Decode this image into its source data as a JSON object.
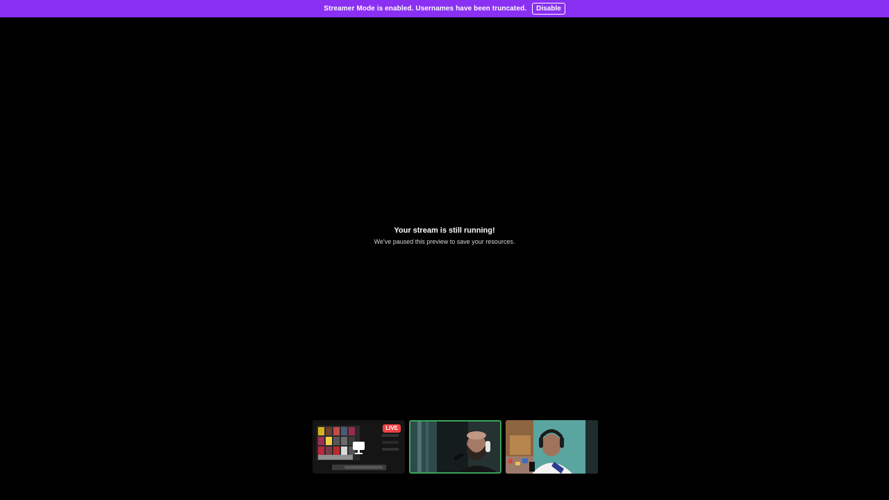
{
  "banner": {
    "message": "Streamer Mode is enabled. Usernames have been truncated.",
    "disable_label": "Disable",
    "background": "#8a30f3"
  },
  "stream": {
    "title": "Your stream is still running!",
    "subtitle": "We've paused this preview to save your resources."
  },
  "tiles": [
    {
      "kind": "screen-share",
      "badge": "LIVE",
      "icon": "screen-share-icon"
    },
    {
      "kind": "camera",
      "active": true
    },
    {
      "kind": "camera",
      "active": false
    }
  ],
  "colors": {
    "live": "#ed4245",
    "active_border": "#3ba55c"
  }
}
